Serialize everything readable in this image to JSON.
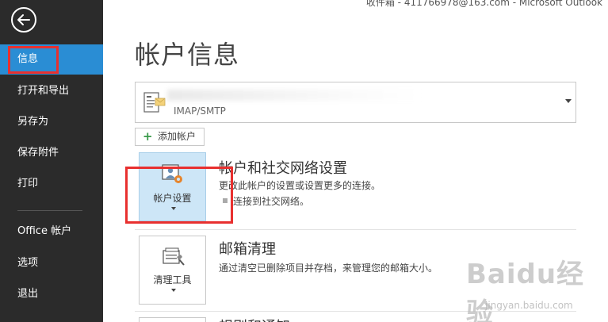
{
  "window": {
    "title": "收件箱 - 411766978@163.com - Microsoft Outlook"
  },
  "sidebar": {
    "items": [
      {
        "label": "信息",
        "active": true
      },
      {
        "label": "打开和导出"
      },
      {
        "label": "另存为"
      },
      {
        "label": "保存附件"
      },
      {
        "label": "打印"
      },
      {
        "label": "Office 帐户"
      },
      {
        "label": "选项"
      },
      {
        "label": "退出"
      }
    ]
  },
  "main": {
    "title": "帐户信息",
    "account": {
      "type": "IMAP/SMTP"
    },
    "add_account_label": "添加帐户",
    "sections": [
      {
        "tile_label": "帐户设置",
        "heading": "帐户和社交网络设置",
        "description": "更改此帐户的设置或设置更多的连接。",
        "bullet": "连接到社交网络。"
      },
      {
        "tile_label": "清理工具",
        "heading": "邮箱清理",
        "description": "通过清空已删除项目并存档，来管理您的邮箱大小。"
      },
      {
        "heading": "规则和通知"
      }
    ]
  },
  "watermark": {
    "logo": "Baidu经验",
    "url": "jingyan.baidu.com"
  },
  "colors": {
    "sidebar_bg": "#2b2b2b",
    "active_item": "#2a8dd4",
    "highlight": "#e8302f",
    "tile_selected": "#cde6f7"
  }
}
